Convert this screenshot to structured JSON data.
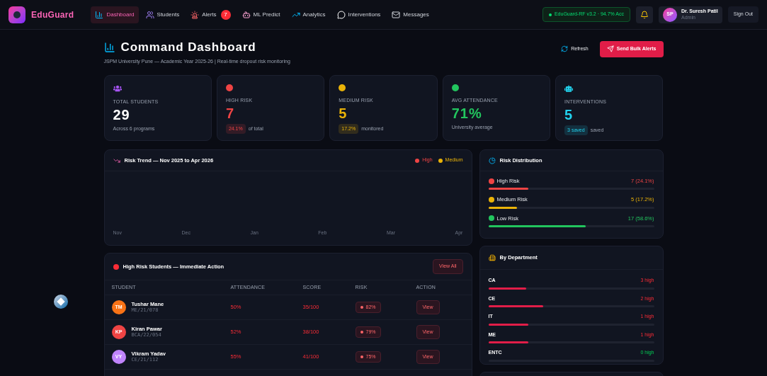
{
  "brand": "EduGuard",
  "nav": [
    {
      "label": "Dashboard",
      "selected": true
    },
    {
      "label": "Students",
      "selected": false
    },
    {
      "label": "Alerts",
      "selected": false,
      "badge": "7"
    },
    {
      "label": "ML Predict",
      "selected": false
    },
    {
      "label": "Analytics",
      "selected": false
    },
    {
      "label": "Interventions",
      "selected": false
    },
    {
      "label": "Messages",
      "selected": false
    }
  ],
  "model_status": "EduGuard-RF v3.2 · 94.7% Acc",
  "user": {
    "initials": "SP",
    "name": "Dr. Suresh Patil",
    "role": "Admin"
  },
  "sign_out": "Sign Out",
  "page": {
    "title": "Command Dashboard",
    "subtitle": "JSPM University Pune — Academic Year 2025-26 | Real-time dropout risk monitoring",
    "refresh": "Refresh",
    "bulk_alerts": "Send Bulk Alerts"
  },
  "stats": [
    {
      "kind": "users",
      "label": "TOTAL STUDENTS",
      "value": "29",
      "note": "Across 6 programs",
      "color": "#a855f7"
    },
    {
      "kind": "dot",
      "label": "HIGH RISK",
      "value": "7",
      "badge": "24.1%",
      "note": "of total",
      "color": "#ef4444"
    },
    {
      "kind": "dot",
      "label": "MEDIUM RISK",
      "value": "5",
      "badge": "17.2%",
      "note": "monitored",
      "color": "#eab308"
    },
    {
      "kind": "dot",
      "label": "AVG ATTENDANCE",
      "value": "71%",
      "note": "University average",
      "color": "#22c55e"
    },
    {
      "kind": "bot",
      "label": "INTERVENTIONS",
      "value": "5",
      "badge": "3 saved",
      "note": "saved",
      "color": "#22d3ee"
    }
  ],
  "risk_trend": {
    "title": "Risk Trend — Nov 2025 to Apr 2026",
    "legend": [
      {
        "label": "High",
        "color": "#ef4444"
      },
      {
        "label": "Medium",
        "color": "#eab308"
      }
    ],
    "months": [
      "Nov",
      "Dec",
      "Jan",
      "Feb",
      "Mar",
      "Apr"
    ]
  },
  "risk_distribution": {
    "title": "Risk Distribution",
    "items": [
      {
        "label": "High Risk",
        "value": "7 (24.1%)",
        "level": 0.241,
        "color": "#ef4444"
      },
      {
        "label": "Medium Risk",
        "value": "5 (17.2%)",
        "level": 0.172,
        "color": "#eab308"
      },
      {
        "label": "Low Risk",
        "value": "17 (58.6%)",
        "level": 0.586,
        "color": "#22c55e"
      }
    ]
  },
  "high_risk": {
    "title": "High Risk Students — Immediate Action",
    "view_all": "View All",
    "columns": [
      "STUDENT",
      "ATTENDANCE",
      "SCORE",
      "RISK",
      "ACTION"
    ],
    "rows": [
      {
        "initials": "TM",
        "name": "Tushar Mane",
        "id": "ME/21/078",
        "attendance": "50%",
        "score": "35/100",
        "risk": "82%",
        "action": "View",
        "color": "#f97316"
      },
      {
        "initials": "KP",
        "name": "Kiran Pawar",
        "id": "BCA/22/054",
        "attendance": "52%",
        "score": "38/100",
        "risk": "79%",
        "action": "View",
        "color": "#ef4444"
      },
      {
        "initials": "VY",
        "name": "Vikram Yadav",
        "id": "CE/21/112",
        "attendance": "55%",
        "score": "41/100",
        "risk": "75%",
        "action": "View",
        "color": "#c084fc"
      }
    ]
  },
  "by_department": {
    "title": "By Department",
    "items": [
      {
        "name": "CA",
        "count": "3 high",
        "level": 0.23,
        "zero": false
      },
      {
        "name": "CE",
        "count": "2 high",
        "level": 0.33,
        "zero": false
      },
      {
        "name": "IT",
        "count": "1 high",
        "level": 0.24,
        "zero": false
      },
      {
        "name": "ME",
        "count": "1 high",
        "level": 0.24,
        "zero": false
      },
      {
        "name": "ENTC",
        "count": "0 high",
        "zero": true
      }
    ]
  }
}
